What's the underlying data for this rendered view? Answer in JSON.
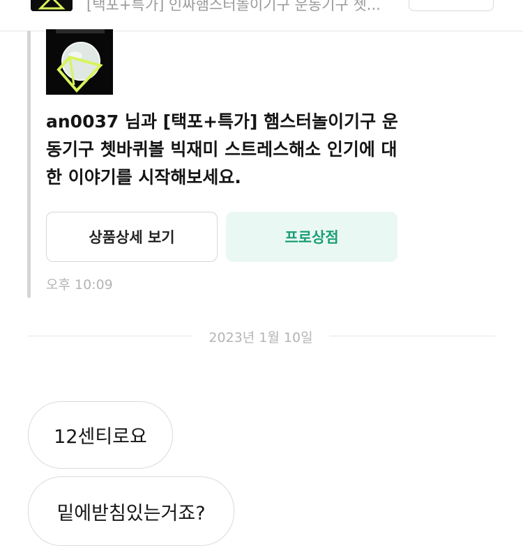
{
  "header": {
    "title": "[택포+특가] 인싸햄스터놀이기구 운동기구 쳇..."
  },
  "product_card": {
    "message": "an0037 님과 [택포+특가] 햄스터놀이기구 운동기구 쳇바퀴볼 빅재미 스트레스해소 인기에 대한 이야기를 시작해보세요.",
    "detail_button": "상품상세 보기",
    "shop_button": "프로상점",
    "time": "오후 10:09"
  },
  "date_divider": "2023년 1월 10일",
  "messages": [
    {
      "text": "12센티로요"
    },
    {
      "text": "밑에받침있는거죠?"
    }
  ],
  "colors": {
    "accent_green": "#1a9e76",
    "shop_button_bg": "#eaf8f3"
  }
}
